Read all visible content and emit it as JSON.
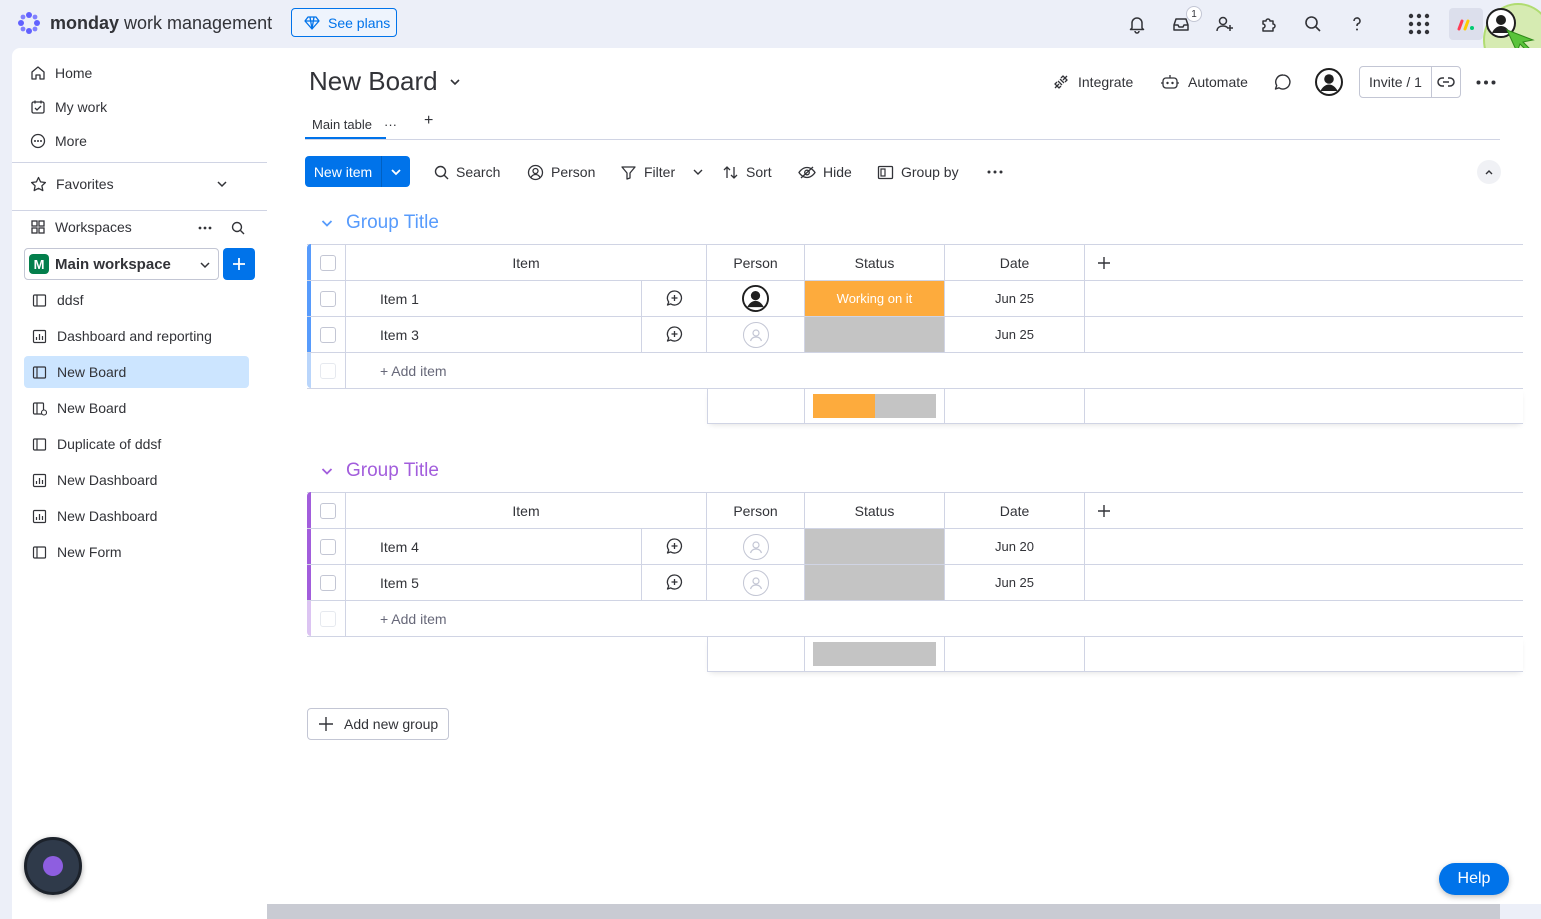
{
  "brand": {
    "name_bold": "monday",
    "name_rest": " work management",
    "see_plans": "See plans"
  },
  "topbar": {
    "inbox_badge": "1"
  },
  "sidebar": {
    "nav": [
      "Home",
      "My work",
      "More"
    ],
    "favorites": "Favorites",
    "workspaces": "Workspaces",
    "workspace_avatar": "M",
    "workspace_name": "Main workspace",
    "boards": [
      "ddsf",
      "Dashboard and reporting",
      "New Board",
      "New Board",
      "Duplicate of ddsf",
      "New Dashboard",
      "New Dashboard",
      "New Form"
    ]
  },
  "board": {
    "title": "New Board",
    "integrate": "Integrate",
    "automate": "Automate",
    "invite": "Invite / 1",
    "tab_main": "Main table",
    "tab_dots": "···",
    "tab_add": "+"
  },
  "toolbar": {
    "new_item": "New item",
    "search": "Search",
    "person": "Person",
    "filter": "Filter",
    "sort": "Sort",
    "hide": "Hide",
    "group_by": "Group by"
  },
  "columns": {
    "item": "Item",
    "person": "Person",
    "status": "Status",
    "date": "Date"
  },
  "groups": [
    {
      "title": "Group Title",
      "color": "#579bfc",
      "light_color": "#b9d5fb",
      "rows": [
        {
          "name": "Item 1",
          "has_person": true,
          "status": "Working on it",
          "status_color": "#fdab3d",
          "date": "Jun 25"
        },
        {
          "name": "Item 3",
          "has_person": false,
          "status": "",
          "status_color": "#c4c4c4",
          "date": "Jun 25"
        }
      ],
      "add_item": "+ Add item",
      "summary": [
        {
          "color": "#fdab3d",
          "fraction": 0.5
        },
        {
          "color": "#c4c4c4",
          "fraction": 0.5
        }
      ]
    },
    {
      "title": "Group Title",
      "color": "#a25ddc",
      "light_color": "#dcc4f2",
      "rows": [
        {
          "name": "Item 4",
          "has_person": false,
          "status": "",
          "status_color": "#c4c4c4",
          "date": "Jun 20"
        },
        {
          "name": "Item 5",
          "has_person": false,
          "status": "",
          "status_color": "#c4c4c4",
          "date": "Jun 25"
        }
      ],
      "add_item": "+ Add item",
      "summary": [
        {
          "color": "#c4c4c4",
          "fraction": 1.0
        }
      ]
    }
  ],
  "add_new_group": "Add new group",
  "help": "Help"
}
